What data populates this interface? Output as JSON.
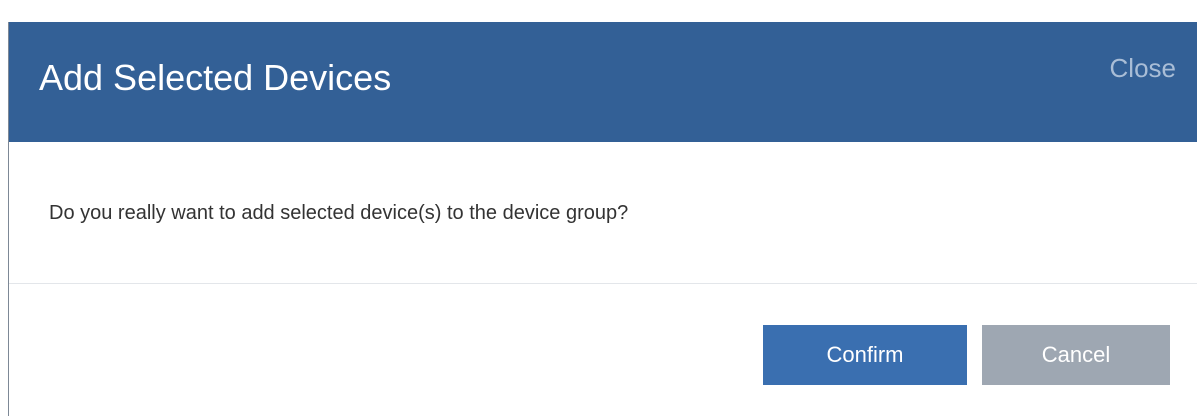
{
  "modal": {
    "title": "Add Selected Devices",
    "close_label": "Close",
    "message": "Do you really want to add selected device(s) to the device group?",
    "confirm_label": "Confirm",
    "cancel_label": "Cancel"
  },
  "colors": {
    "header_bg": "#336096",
    "title_text": "#ffffff",
    "close_text": "#a9bdd6",
    "confirm_bg": "#3a6fb0",
    "cancel_bg": "#9ea7b2",
    "message_text": "#333333"
  }
}
